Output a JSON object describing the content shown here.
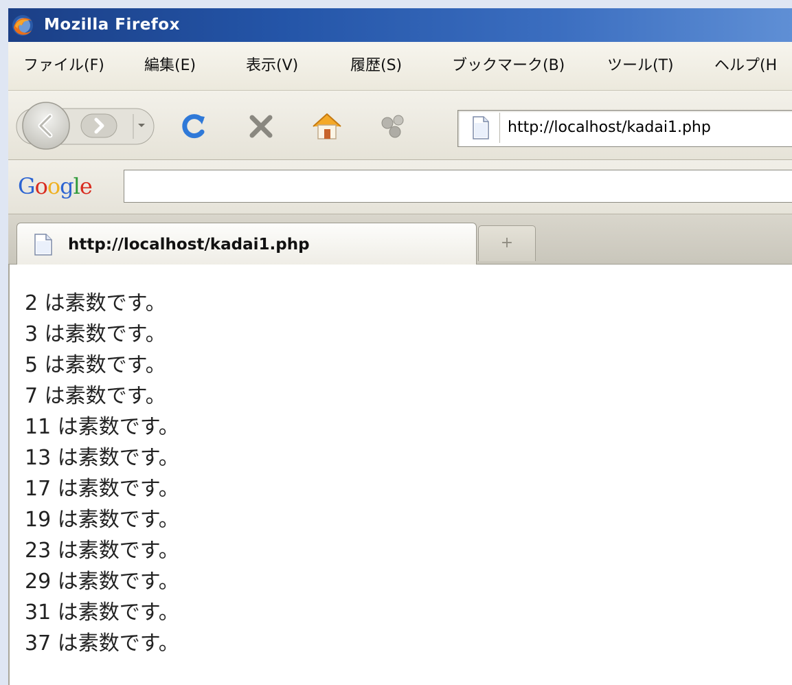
{
  "window": {
    "title": "Mozilla Firefox"
  },
  "menu": {
    "items": [
      "ファイル(F)",
      "編集(E)",
      "表示(V)",
      "履歴(S)",
      "ブックマーク(B)",
      "ツール(T)",
      "ヘルプ(H"
    ]
  },
  "navbar": {
    "url": "http://localhost/kadai1.php"
  },
  "google": {
    "logo_letters": [
      "G",
      "o",
      "o",
      "g",
      "l",
      "e"
    ],
    "logo_colors": [
      "#2c64d2",
      "#d82b1f",
      "#efb021",
      "#2c64d2",
      "#2e9a3a",
      "#d82b1f"
    ],
    "search_value": ""
  },
  "tabs": {
    "active_title": "http://localhost/kadai1.php",
    "new_tab_glyph": "+"
  },
  "page": {
    "lines": [
      "2 は素数です。",
      "3 は素数です。",
      "5 は素数です。",
      "7 は素数です。",
      "11 は素数です。",
      "13 は素数です。",
      "17 は素数です。",
      "19 は素数です。",
      "23 は素数です。",
      "29 は素数です。",
      "31 は素数です。",
      "37 は素数です。"
    ]
  },
  "colors": {
    "titlebar_start": "#1b3f86",
    "titlebar_end": "#5f8fd5",
    "reload_blue": "#2f79d8",
    "stop_gray": "#8a8880"
  }
}
